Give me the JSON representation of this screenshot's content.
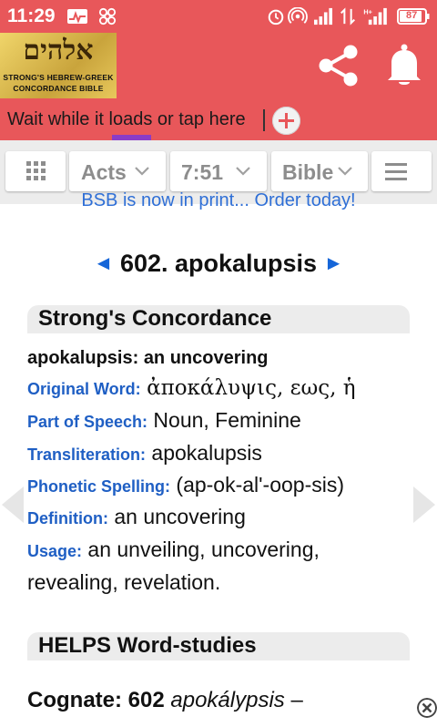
{
  "status_bar": {
    "time": "11:29",
    "battery": "87",
    "icons": [
      "activity-icon",
      "pinwheel-icon",
      "alarm-icon",
      "hotspot-icon",
      "signal-icon",
      "data-arrows-icon",
      "signal-h-plus-icon",
      "battery-icon"
    ]
  },
  "header": {
    "logo_hebrew": "אלהים",
    "logo_line1": "STRONG'S HEBREW-GREEK",
    "logo_line2": "CONCORDANCE BIBLE",
    "loading_text": "Wait while it loads or tap here",
    "accent": "#e8575a"
  },
  "nav": {
    "book": "Acts",
    "chapter_verse": "7:51",
    "version": "Bible"
  },
  "promo": "BSB is now in print... Order today!",
  "entry": {
    "number_title": "602. apokalupsis",
    "prev_arrow": "◄",
    "next_arrow": "►",
    "section1_title": "Strong's Concordance",
    "short_def": "apokalupsis: an uncovering",
    "original_word_label": "Original Word:",
    "original_word": "ἀποκάλυψις, εως, ἡ",
    "pos_label": "Part of Speech:",
    "pos": "Noun, Feminine",
    "translit_label": "Transliteration:",
    "translit": "apokalupsis",
    "phonetic_label": "Phonetic Spelling:",
    "phonetic": "(ap-ok-al'-oop-sis)",
    "definition_label": "Definition:",
    "definition": "an uncovering",
    "usage_label": "Usage:",
    "usage_line1": "an unveiling, uncovering,",
    "usage_line2": "revealing, revelation.",
    "section2_title": "HELPS Word-studies",
    "cognate_label": "Cognate: 602",
    "cognate_word": "apokálypsis",
    "cognate_dash": "–"
  },
  "colors": {
    "link_blue": "#1f5fc4",
    "section_bg": "#ececec",
    "progress": "#8a3cc6"
  }
}
